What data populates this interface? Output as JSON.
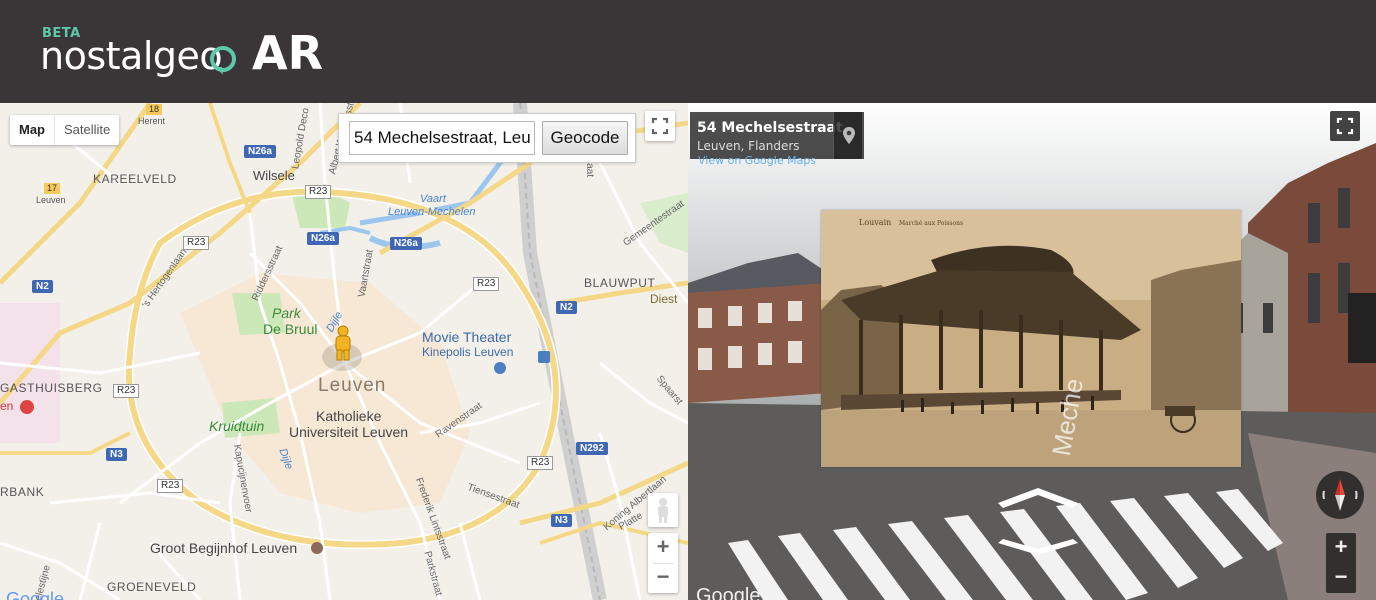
{
  "header": {
    "beta_label": "BETA",
    "brand_name": "nostalgeo",
    "ar_label": "AR",
    "brand_pin_icon": "location-pin-icon",
    "colors": {
      "background": "#3a3638",
      "accent": "#5ec9a8"
    }
  },
  "map": {
    "map_type": {
      "map_label": "Map",
      "satellite_label": "Satellite",
      "selected": "Map"
    },
    "search": {
      "value": "54 Mechelsestraat, Leuven",
      "button_label": "Geocode"
    },
    "labels": {
      "kareelveld": "KAREELVELD",
      "wilsele": "Wilsele",
      "blauwput": "BLAUWPUT",
      "diest": "Diest",
      "gasthuisberg": "GASTHUISBERG",
      "leuven": "Leuven",
      "park": "Park",
      "de_bruul": "De Bruul",
      "movie_theater": "Movie Theater",
      "kinepolis": "Kinepolis Leuven",
      "kruidtuin": "Kruidtuin",
      "katholieke": "Katholieke",
      "universiteit": "Universiteit Leuven",
      "rbank": "RBANK",
      "begijnhof": "Groot Begijnhof Leuven",
      "groeneveld": "GROENEVELD",
      "vaart": "Vaart",
      "leuven_mechelen": "Leuven-Mechelen",
      "dijle": "Dijle",
      "dijle2": "Dijle",
      "herent": "Herent",
      "leuven_small": "Leuven",
      "en": "en"
    },
    "streets": {
      "s_hertogenlaan": "'s Hertogenlaan",
      "riddersstraat": "Riddersstraat",
      "vaartstraat": "Vaartstraat",
      "leopold": "Leopold Deco",
      "albert": "Albert Woutersst",
      "gemeentestraat": "Gemeentestraat",
      "spaarstraat": "Spaarst",
      "ravenstraat": "Ravenstraat",
      "tiensestraat": "Tiensestraat",
      "frederik": "Frederik Lintsstraat",
      "parkstraat": "Parkstraat",
      "kapucijnenvoer": "Kapucijnenvoer",
      "koning_albert": "Koning Albertlaan",
      "platte": "Platte",
      "celestijne": "Celestijne",
      "muntstraat": "Muntstraat"
    },
    "road_shields": {
      "n26a_1": "N26a",
      "n26a_2": "N26a",
      "n26a_3": "N26a",
      "r23_1": "R23",
      "r23_2": "R23",
      "r23_3": "R23",
      "r23_4": "R23",
      "r23_5": "R23",
      "r23_6": "R23",
      "n2_1": "N2",
      "n2_2": "N2",
      "n3_1": "N3",
      "n3_2": "N3",
      "n292": "N292",
      "exit18": "18",
      "exit17": "17"
    },
    "icons": {
      "fullscreen": "fullscreen-icon",
      "pegman": "pegman-icon",
      "zoom_in": "+",
      "zoom_out": "−"
    },
    "google_label": "Google"
  },
  "street_view": {
    "address_title": "54 Mechelsestraat",
    "address_sub": "Leuven, Flanders",
    "view_link": "View on Google Maps",
    "road_name": "Meche",
    "photo": {
      "caption_city": "Louvain",
      "caption_title": "Marché aux Poissons"
    },
    "controls": {
      "zoom_in": "+",
      "zoom_out": "−",
      "compass_icon": "compass-icon",
      "fullscreen_icon": "fullscreen-icon",
      "pin_icon": "map-pin-icon"
    },
    "google_label": "Google"
  }
}
